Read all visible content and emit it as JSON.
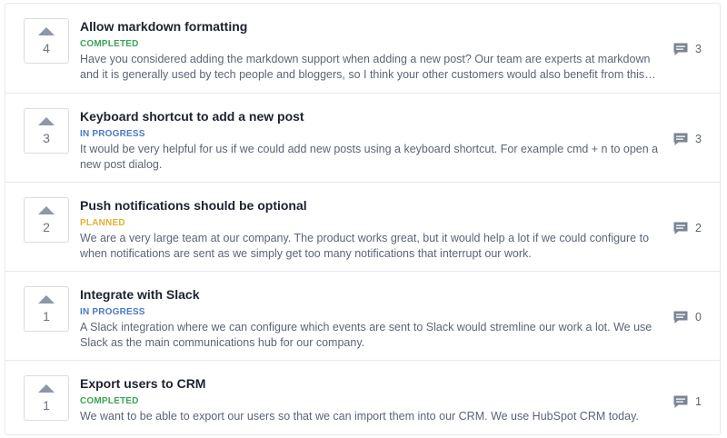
{
  "colors": {
    "completed": "#3aa757",
    "in_progress": "#4a78c8",
    "planned": "#e0b22c",
    "icon": "#7b8594"
  },
  "posts": [
    {
      "votes": "4",
      "title": "Allow markdown formatting",
      "status": "COMPLETED",
      "status_key": "completed",
      "description": "Have you considered adding the markdown support when adding a new post? Our team are experts at markdown and it is generally used by tech people and bloggers, so I think your other customers would also benefit from this change. Wh...",
      "comments": "3",
      "icon": "upvote-arrow-icon"
    },
    {
      "votes": "3",
      "title": "Keyboard shortcut to add a new post",
      "status": "IN PROGRESS",
      "status_key": "in_progress",
      "description": "It would be very helpful for us if we could add new posts using a keyboard shortcut. For example cmd + n to open a new post dialog.",
      "comments": "3",
      "icon": "upvote-arrow-icon"
    },
    {
      "votes": "2",
      "title": "Push notifications should be optional",
      "status": "PLANNED",
      "status_key": "planned",
      "description": "We are a very large team at our company. The product works great, but it would help a lot if we could configure to when notifications are sent as we simply get too many notifications that interrupt our work.",
      "comments": "2",
      "icon": "upvote-arrow-icon"
    },
    {
      "votes": "1",
      "title": "Integrate with Slack",
      "status": "IN PROGRESS",
      "status_key": "in_progress",
      "description": "A Slack integration where we can configure which events are sent to Slack would stremline our work a lot. We use Slack as the main communications hub for our company.",
      "comments": "0",
      "icon": "upvote-arrow-icon"
    },
    {
      "votes": "1",
      "title": "Export users to CRM",
      "status": "COMPLETED",
      "status_key": "completed",
      "description": "We want to be able to export our users so that we can import them into our CRM. We use HubSpot CRM today.",
      "comments": "1",
      "icon": "upvote-arrow-icon"
    }
  ]
}
